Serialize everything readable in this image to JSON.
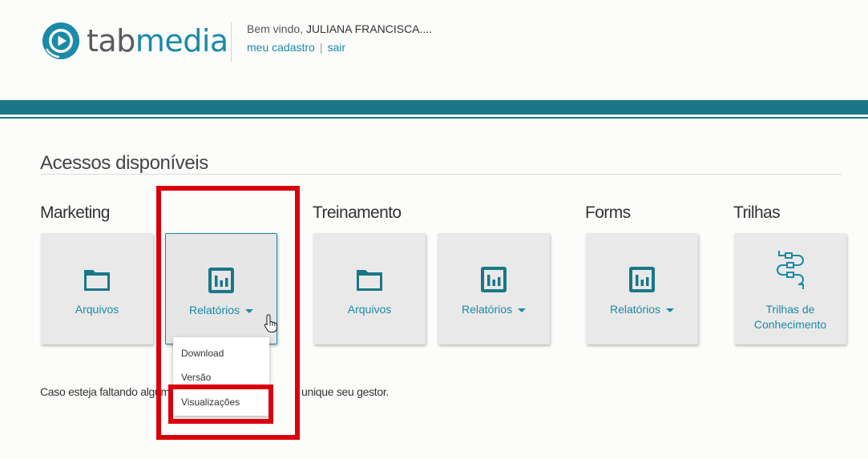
{
  "header": {
    "logo": {
      "part1": "tab",
      "part2": "media"
    },
    "welcome_prefix": "Bem vindo, ",
    "user_name": "JULIANA FRANCISCA....",
    "links": {
      "profile": "meu cadastro",
      "separator": "|",
      "logout": "sair"
    }
  },
  "main": {
    "title": "Acessos disponíveis",
    "groups": [
      {
        "title": "Marketing",
        "tiles": [
          {
            "label": "Arquivos",
            "icon": "folder-icon"
          },
          {
            "label": "Relatórios",
            "icon": "report-icon",
            "has_dropdown": true,
            "active": true
          }
        ]
      },
      {
        "title": "Treinamento",
        "tiles": [
          {
            "label": "Arquivos",
            "icon": "folder-icon"
          },
          {
            "label": "Relatórios",
            "icon": "report-icon",
            "has_dropdown": true
          }
        ]
      },
      {
        "title": "Forms",
        "tiles": [
          {
            "label": "Relatórios",
            "icon": "report-icon",
            "has_dropdown": true
          }
        ]
      },
      {
        "title": "Trilhas",
        "tiles": [
          {
            "label_line1": "Trilhas de",
            "label_line2": "Conhecimento",
            "icon": "flow-icon"
          }
        ]
      }
    ],
    "dropdown": {
      "items": [
        "Download",
        "Versão",
        "Visualizações"
      ]
    },
    "footer_note": {
      "left": "Caso esteja faltando alguma",
      "right": "unique seu gestor."
    }
  },
  "colors": {
    "accent": "#1a8aa8",
    "band": "#1a7787",
    "highlight": "#d9000d",
    "tile_bg": "#e9e9e9"
  }
}
